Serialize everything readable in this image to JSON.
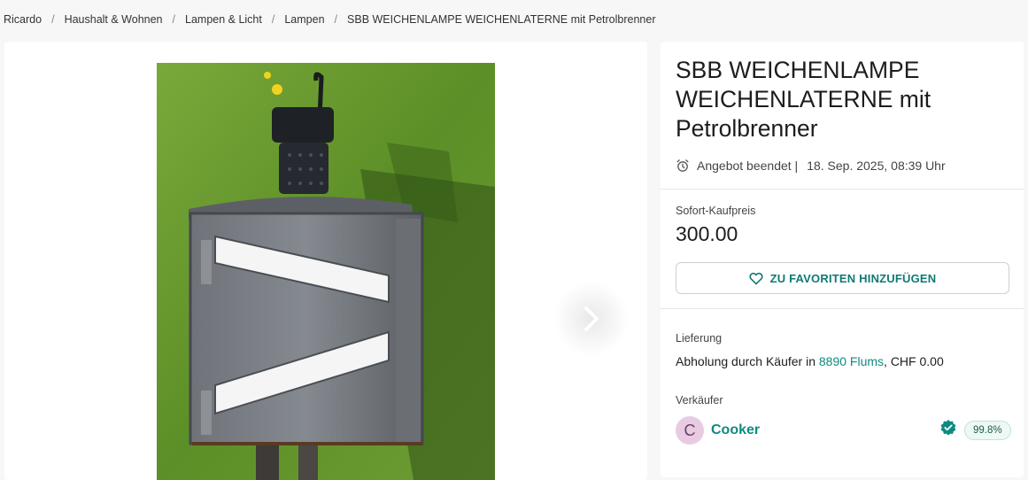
{
  "breadcrumb": [
    "Ricardo",
    "Haushalt & Wohnen",
    "Lampen & Licht",
    "Lampen",
    "SBB WEICHENLAMPE WEICHENLATERNE mit Petrolbrenner"
  ],
  "gallery": {
    "prev_icon": "chevron-left-icon",
    "next_icon": "chevron-right-icon"
  },
  "listing": {
    "title": "SBB WEICHENLAMPE WEICHENLATERNE mit Petrolbrenner",
    "status": "Angebot beendet |",
    "end_date": "18. Sep. 2025, 08:39 Uhr",
    "price_label": "Sofort-Kaufpreis",
    "price": "300.00",
    "favorite_button": "ZU FAVORITEN HINZUFÜGEN"
  },
  "delivery": {
    "label": "Lieferung",
    "text_before": "Abholung durch Käufer in ",
    "location": "8890 Flums",
    "text_after": ", CHF 0.00"
  },
  "seller": {
    "label": "Verkäufer",
    "avatar_letter": "C",
    "name": "Cooker",
    "rating": "99.8%"
  },
  "colors": {
    "accent": "#0f8a80",
    "avatar_bg": "#e8cbe3"
  }
}
